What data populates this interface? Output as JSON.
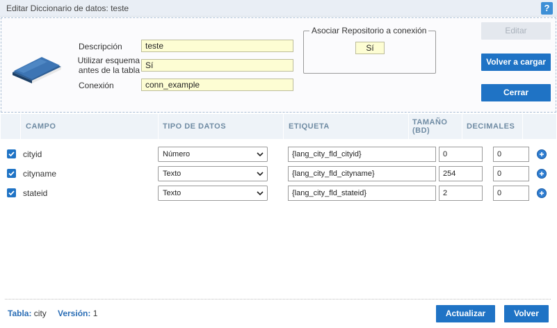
{
  "window": {
    "title": "Editar Diccionario de datos: teste",
    "help_label": "?"
  },
  "form": {
    "descripcion_label": "Descripción",
    "descripcion_value": "teste",
    "esquema_label_line1": "Utilizar esquema",
    "esquema_label_line2": "antes de la tabla",
    "esquema_value": "Sí",
    "conexion_label": "Conexión",
    "conexion_value": "conn_example",
    "repo_legend": "Asociar Repositorio a conexión",
    "repo_value": "Sí"
  },
  "actions": {
    "edit": "Editar",
    "reload": "Volver a cargar",
    "close": "Cerrar"
  },
  "grid": {
    "headers": {
      "campo": "CAMPO",
      "tipo": "TIPO DE DATOS",
      "etiqueta": "ETIQUETA",
      "tamano_line1": "TAMAÑO",
      "tamano_line2": "(BD)",
      "decimales": "DECIMALES"
    },
    "rows": [
      {
        "checked": true,
        "field": "cityid",
        "type": "Número",
        "label": "{lang_city_fld_cityid}",
        "size": "0",
        "decimals": "0"
      },
      {
        "checked": true,
        "field": "cityname",
        "type": "Texto",
        "label": "{lang_city_fld_cityname}",
        "size": "254",
        "decimals": "0"
      },
      {
        "checked": true,
        "field": "stateid",
        "type": "Texto",
        "label": "{lang_city_fld_stateid}",
        "size": "2",
        "decimals": "0"
      }
    ]
  },
  "footer": {
    "tabla_label": "Tabla:",
    "tabla_value": "city",
    "version_label": "Versión:",
    "version_value": "1",
    "update_button": "Actualizar",
    "back_button": "Volver"
  },
  "colors": {
    "accent": "#1f73c5",
    "field_bg": "#fdfdd3",
    "header_bg": "#eef3f8"
  },
  "icons": [
    "book-icon",
    "help-icon",
    "checkbox-checked-icon",
    "chevron-down-icon",
    "plus-circle-icon"
  ]
}
